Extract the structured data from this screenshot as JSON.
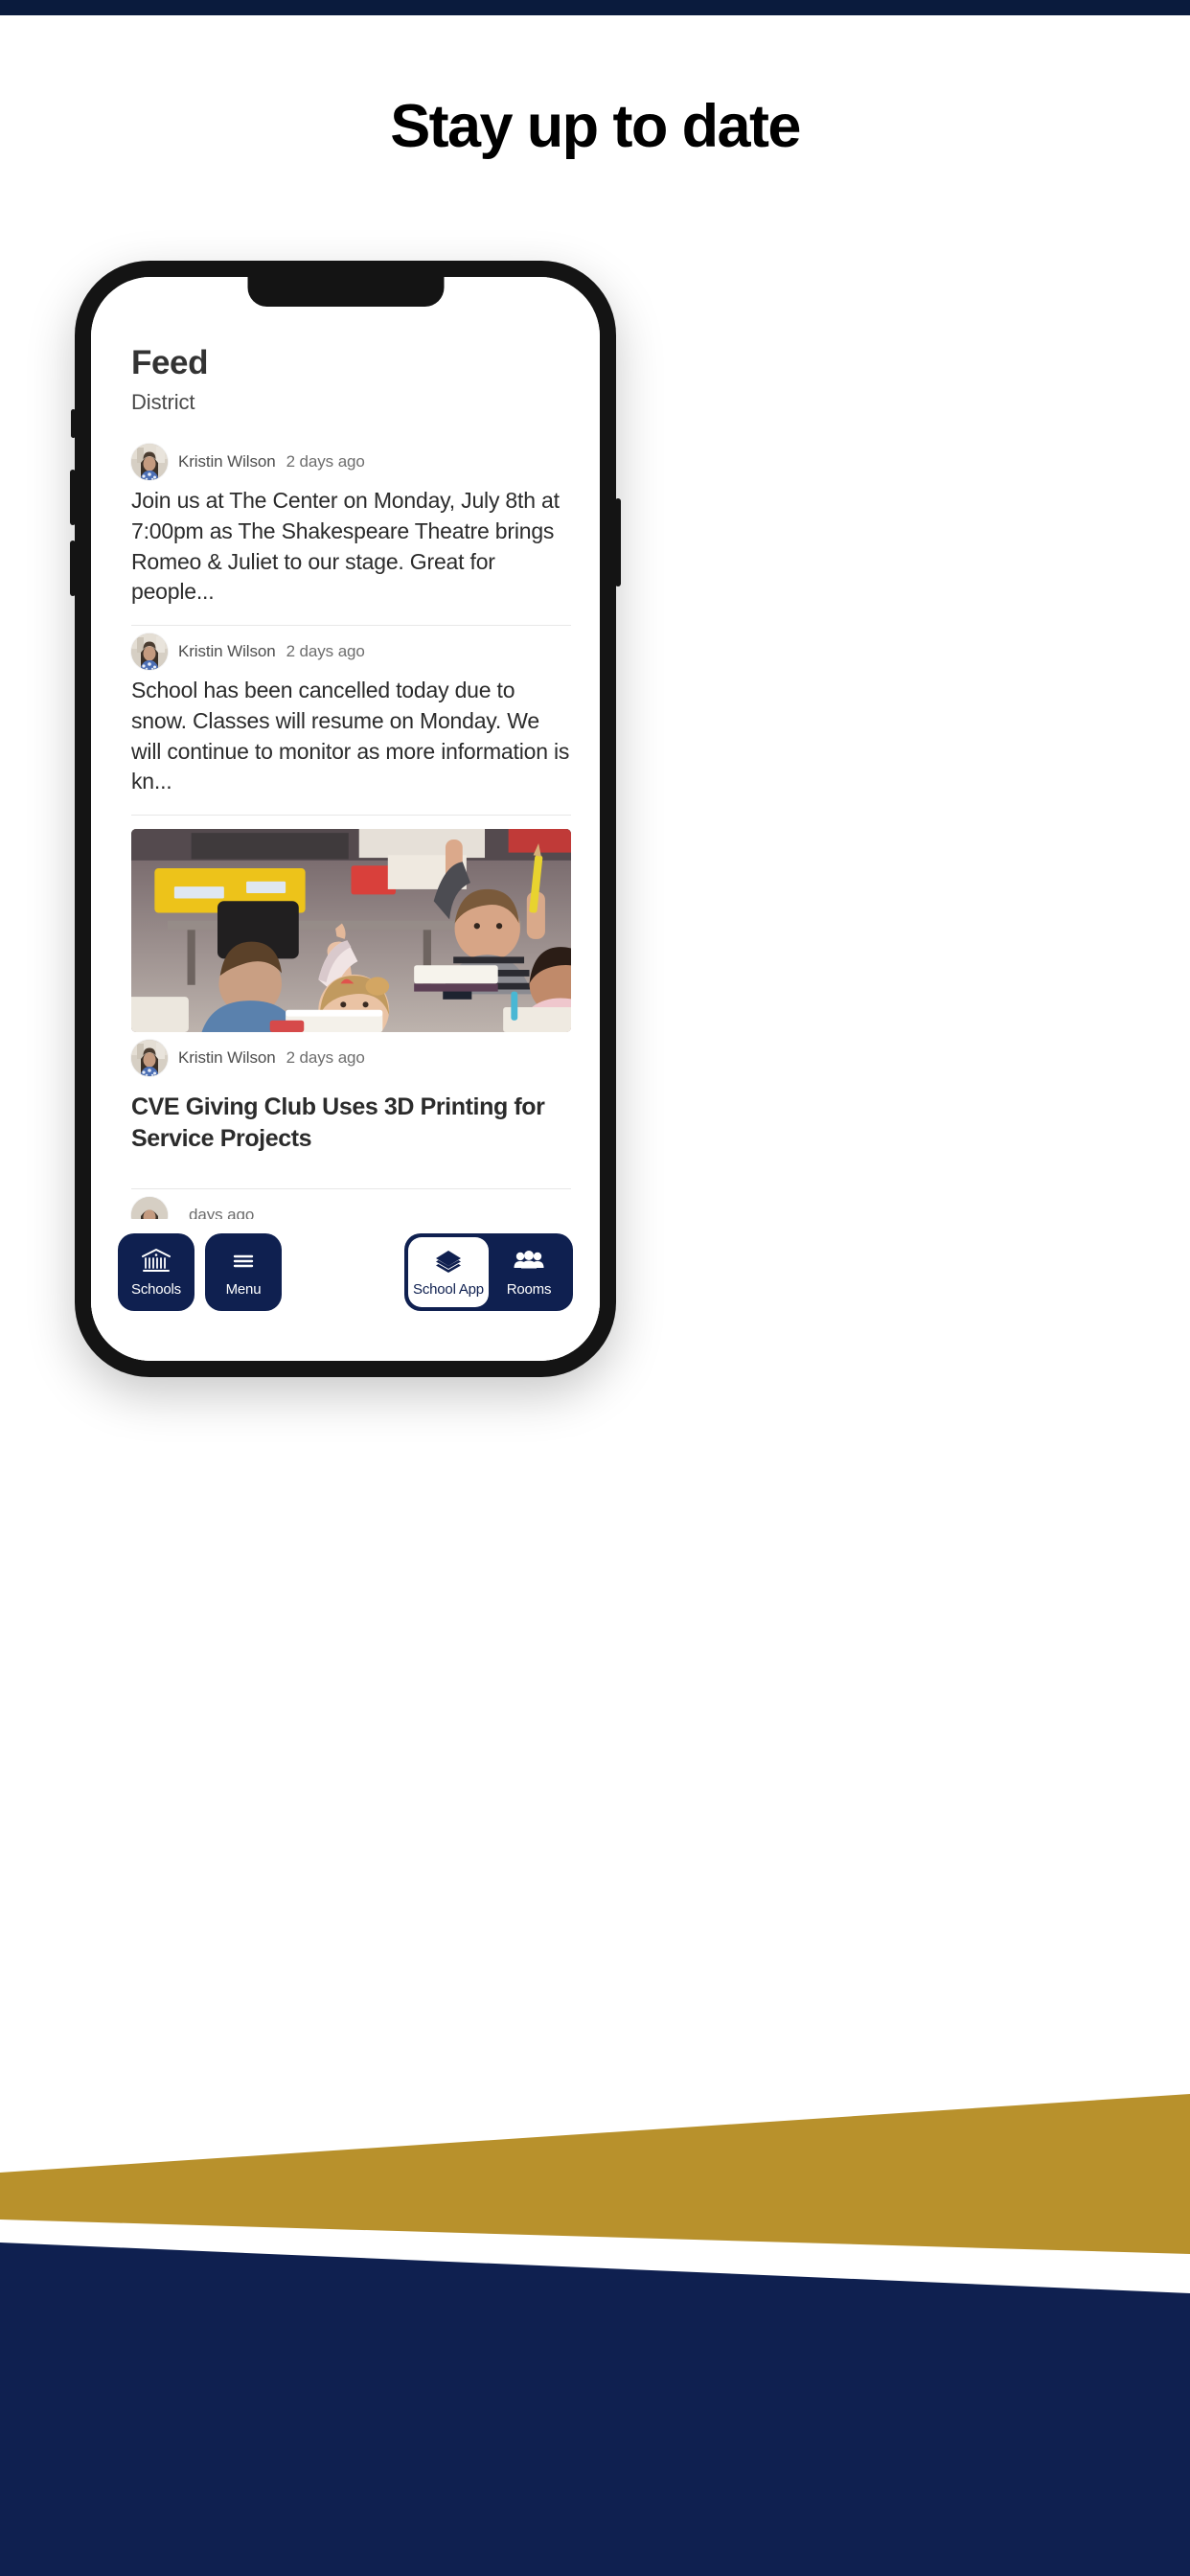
{
  "page": {
    "hero_title": "Stay up to date",
    "brand_navy": "#0f2050",
    "brand_gold": "#b8912c",
    "top_strip_color": "#0a1b3d"
  },
  "app": {
    "header": {
      "title": "Feed",
      "subtitle": "District"
    },
    "posts": [
      {
        "author": "Kristin Wilson",
        "time": "2 days ago",
        "body": "Join us at The Center on Monday, July 8th at 7:00pm as The Shakespeare Theatre brings Romeo & Juliet to our stage. Great for people...",
        "avatar_icon": "user-avatar-photo"
      },
      {
        "author": "Kristin Wilson",
        "time": "2 days ago",
        "body": "School has been cancelled today due to snow. Classes will resume on Monday. We will continue to monitor as more information is kn...",
        "avatar_icon": "user-avatar-photo"
      },
      {
        "author": "Kristin Wilson",
        "time": "2 days ago",
        "headline": "CVE Giving Club Uses 3D Printing for Service Projects",
        "image_alt": "classroom-students-raising-hands",
        "avatar_icon": "user-avatar-photo"
      },
      {
        "author": "",
        "time": "days ago",
        "body": "",
        "avatar_icon": "user-avatar-photo"
      }
    ],
    "bottom_nav": {
      "items": [
        {
          "label": "Schools",
          "icon": "bank-building-icon",
          "active": false
        },
        {
          "label": "Menu",
          "icon": "hamburger-icon",
          "active": false
        },
        {
          "label": "School App",
          "icon": "layers-stack-icon",
          "active": true
        },
        {
          "label": "Rooms",
          "icon": "people-group-icon",
          "active": false
        }
      ]
    }
  }
}
